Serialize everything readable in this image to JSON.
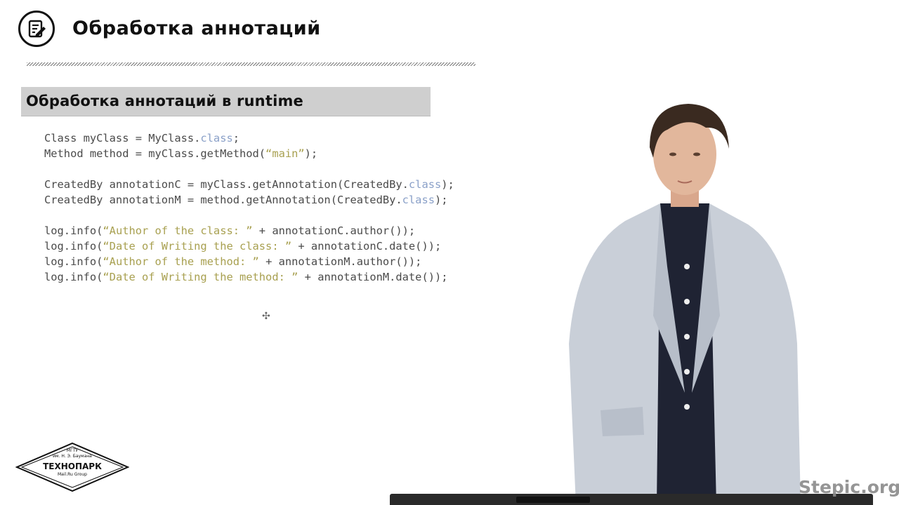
{
  "header": {
    "title": "Обработка аннотаций",
    "icon": "notepad-edit-icon"
  },
  "section": {
    "title": "Обработка аннотаций в runtime"
  },
  "code": {
    "lines": [
      [
        {
          "t": "Class myClass = MyClass.",
          "c": ""
        },
        {
          "t": "class",
          "c": "kw"
        },
        {
          "t": ";",
          "c": ""
        }
      ],
      [
        {
          "t": "Method method = myClass.getMethod(",
          "c": ""
        },
        {
          "t": "“main”",
          "c": "str"
        },
        {
          "t": ");",
          "c": ""
        }
      ],
      [],
      [
        {
          "t": "CreatedBy annotationC = myClass.getAnnotation(CreatedBy.",
          "c": ""
        },
        {
          "t": "class",
          "c": "kw"
        },
        {
          "t": ");",
          "c": ""
        }
      ],
      [
        {
          "t": "CreatedBy annotationM = method.getAnnotation(CreatedBy.",
          "c": ""
        },
        {
          "t": "class",
          "c": "kw"
        },
        {
          "t": ");",
          "c": ""
        }
      ],
      [],
      [
        {
          "t": "log.info(",
          "c": ""
        },
        {
          "t": "“Author of the class: ”",
          "c": "str"
        },
        {
          "t": " + annotationC.author());",
          "c": ""
        }
      ],
      [
        {
          "t": "log.info(",
          "c": ""
        },
        {
          "t": "“Date of Writing the class: ”",
          "c": "str"
        },
        {
          "t": " + annotationC.date());",
          "c": ""
        }
      ],
      [
        {
          "t": "log.info(",
          "c": ""
        },
        {
          "t": "“Author of the method: ”",
          "c": "str"
        },
        {
          "t": " + annotationM.author());",
          "c": ""
        }
      ],
      [
        {
          "t": "log.info(",
          "c": ""
        },
        {
          "t": "“Date of Writing the method: ”",
          "c": "str"
        },
        {
          "t": " + annotationM.date());",
          "c": ""
        }
      ]
    ],
    "colors": {
      "text": "#4a4a4a",
      "keyword": "#8aa0c8",
      "string": "#a8a050"
    }
  },
  "logo": {
    "line1": "МГТУ",
    "line2": "им. Н. Э. Баумана",
    "name": "ТЕХНОПАРК",
    "sub": "Mail.Ru Group"
  },
  "watermark": "Stepic.org",
  "cursor_icon": "move-cursor-icon"
}
